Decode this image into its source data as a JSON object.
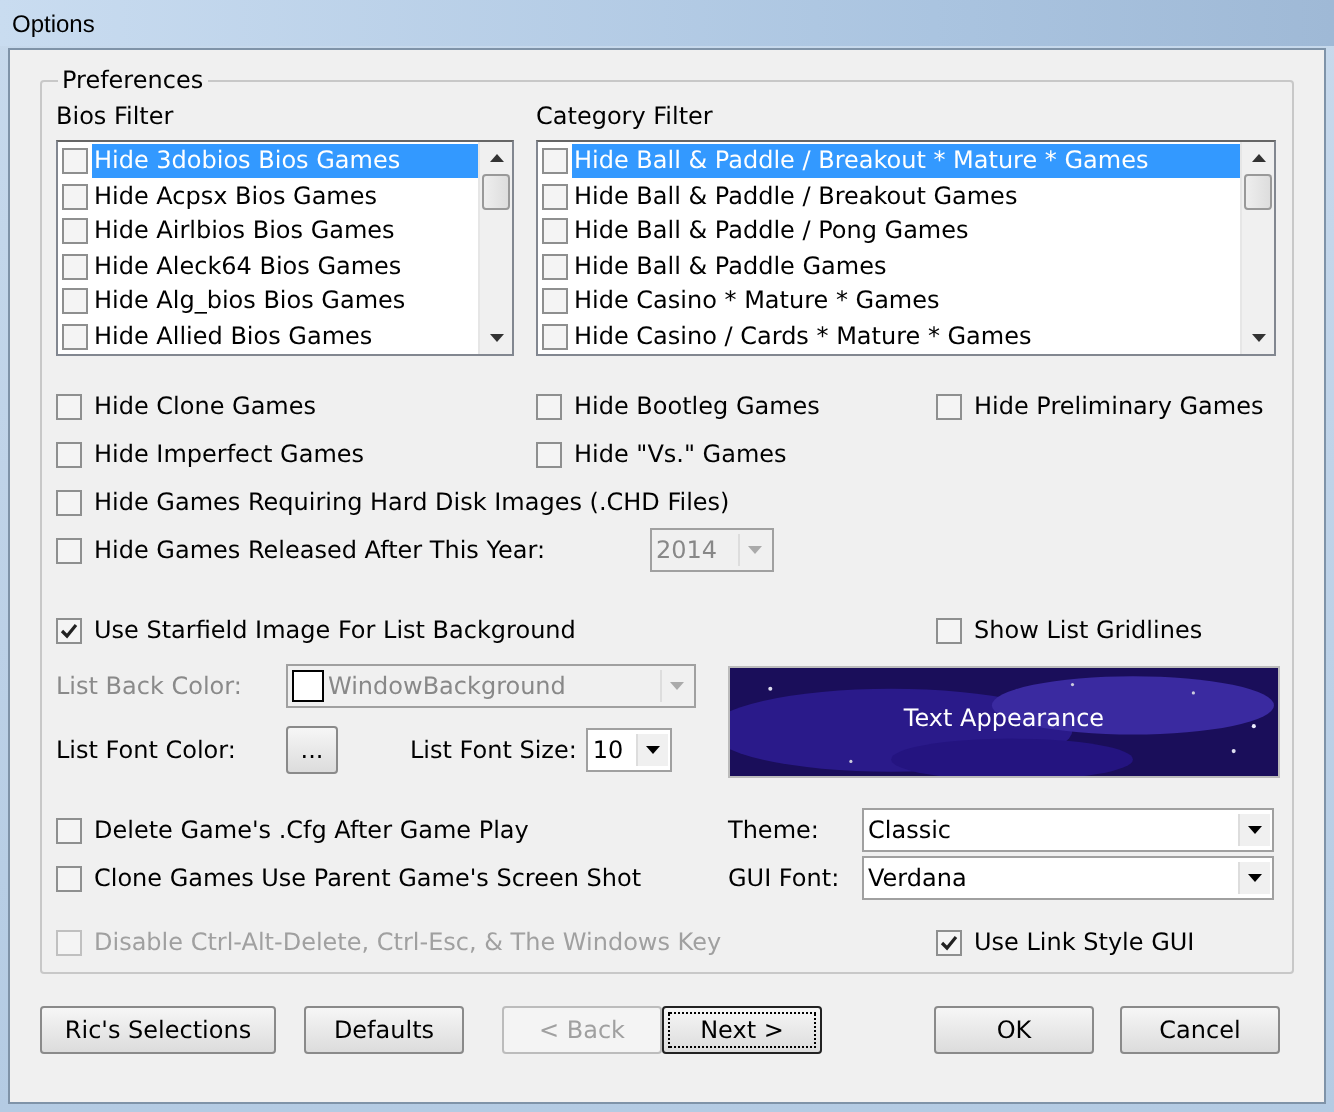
{
  "window": {
    "title": "Options"
  },
  "group": {
    "title": "Preferences"
  },
  "bios_filter": {
    "label": "Bios Filter",
    "items": [
      {
        "label": "Hide 3dobios Bios Games",
        "checked": false,
        "selected": true
      },
      {
        "label": "Hide Acpsx Bios Games",
        "checked": false,
        "selected": false
      },
      {
        "label": "Hide Airlbios Bios Games",
        "checked": false,
        "selected": false
      },
      {
        "label": "Hide Aleck64 Bios Games",
        "checked": false,
        "selected": false
      },
      {
        "label": "Hide Alg_bios Bios Games",
        "checked": false,
        "selected": false
      },
      {
        "label": "Hide Allied Bios Games",
        "checked": false,
        "selected": false
      }
    ]
  },
  "category_filter": {
    "label": "Category Filter",
    "items": [
      {
        "label": "Hide Ball & Paddle / Breakout * Mature * Games",
        "checked": false,
        "selected": true
      },
      {
        "label": "Hide Ball & Paddle / Breakout Games",
        "checked": false,
        "selected": false
      },
      {
        "label": "Hide Ball & Paddle / Pong Games",
        "checked": false,
        "selected": false
      },
      {
        "label": "Hide Ball & Paddle Games",
        "checked": false,
        "selected": false
      },
      {
        "label": "Hide Casino * Mature * Games",
        "checked": false,
        "selected": false
      },
      {
        "label": "Hide Casino / Cards * Mature * Games",
        "checked": false,
        "selected": false
      }
    ]
  },
  "hide_rows": [
    [
      {
        "label": "Hide Clone Games",
        "checked": false
      },
      {
        "label": "Hide Bootleg Games",
        "checked": false
      },
      {
        "label": "Hide Preliminary Games",
        "checked": false
      }
    ],
    [
      {
        "label": "Hide Imperfect Games",
        "checked": false
      },
      {
        "label": "Hide \"Vs.\" Games",
        "checked": false
      }
    ],
    [
      {
        "label": "Hide Games Requiring Hard Disk Images (.CHD Files)",
        "checked": false
      }
    ]
  ],
  "year_option": {
    "label": "Hide Games Released After This Year:",
    "checked": false,
    "value": "2014",
    "disabled": true
  },
  "starfield": {
    "label": "Use Starfield Image For List Background",
    "checked": true
  },
  "gridlines": {
    "label": "Show List Gridlines",
    "checked": false
  },
  "list_back_color": {
    "label": "List Back Color:",
    "value": "WindowBackground",
    "disabled": true
  },
  "list_font_color": {
    "label": "List Font Color:",
    "button": "..."
  },
  "list_font_size": {
    "label": "List Font Size:",
    "value": "10"
  },
  "preview": {
    "text": "Text Appearance"
  },
  "delete_cfg": {
    "label": "Delete Game's .Cfg After Game Play",
    "checked": false
  },
  "clone_shot": {
    "label": "Clone Games Use Parent Game's Screen Shot",
    "checked": false
  },
  "theme": {
    "label": "Theme:",
    "value": "Classic"
  },
  "gui_font": {
    "label": "GUI Font:",
    "value": "Verdana"
  },
  "disable_keys": {
    "label": "Disable Ctrl-Alt-Delete, Ctrl-Esc, & The Windows Key",
    "checked": false,
    "disabled": true
  },
  "link_style": {
    "label": "Use Link Style GUI",
    "checked": true
  },
  "buttons": [
    {
      "label": "Ric's Selections",
      "disabled": false,
      "focused": false
    },
    {
      "label": "Defaults",
      "disabled": false,
      "focused": false
    },
    {
      "label": "< Back",
      "disabled": true,
      "focused": false
    },
    {
      "label": "Next >",
      "disabled": false,
      "focused": true
    },
    {
      "label": "OK",
      "disabled": false,
      "focused": false
    },
    {
      "label": "Cancel",
      "disabled": false,
      "focused": false
    }
  ]
}
